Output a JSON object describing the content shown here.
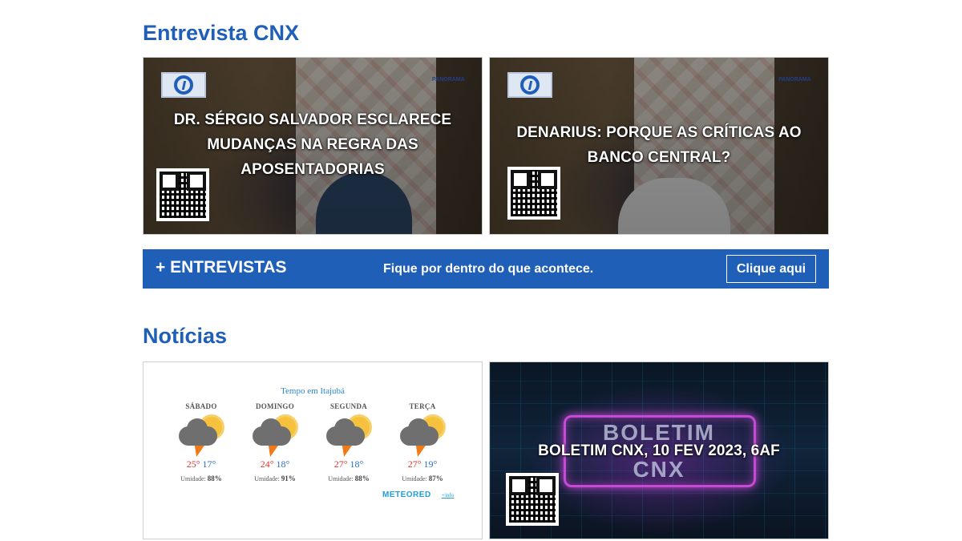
{
  "sections": {
    "interviews_title": "Entrevista CNX",
    "news_title": "Notícias"
  },
  "interviews": [
    {
      "title_line1": "DR. SÉRGIO SALVADOR ESCLARECE",
      "title_line2": "MUDANÇAS NA REGRA DAS",
      "title_line3": "APOSENTADORIAS",
      "watermark": "PANORAMA"
    },
    {
      "title_line1": "DENARIUS: PORQUE AS CRÍTICAS AO",
      "title_line2": "BANCO CENTRAL?",
      "watermark": "PANORAMA"
    }
  ],
  "banner": {
    "left_label": "+ ENTREVISTAS",
    "tagline": "Fique por dentro do que acontece.",
    "button_label": "Clique aqui",
    "color": "#1f5fb8"
  },
  "weather": {
    "title": "Tempo em Itajubá",
    "days": [
      {
        "name": "SÁBADO",
        "max": "25°",
        "min": "17°",
        "humidity_label": "Umidade:",
        "humidity": "88%",
        "icon": "storm-sun-icon"
      },
      {
        "name": "DOMINGO",
        "max": "24°",
        "min": "18°",
        "humidity_label": "Umidade:",
        "humidity": "91%",
        "icon": "storm-sun-icon"
      },
      {
        "name": "SEGUNDA",
        "max": "27°",
        "min": "18°",
        "humidity_label": "Umidade:",
        "humidity": "88%",
        "icon": "storm-sun-icon"
      },
      {
        "name": "TERÇA",
        "max": "27°",
        "min": "19°",
        "humidity_label": "Umidade:",
        "humidity": "87%",
        "icon": "storm-sun-icon"
      }
    ],
    "brand": "METEORED",
    "info_link": "+info"
  },
  "boletim": {
    "title": "BOLETIM CNX, 10 FEV 2023, 6AF",
    "bg_word_top": "BOLETIM",
    "bg_word_bottom": "CNX"
  },
  "colors": {
    "accent": "#1f5fb8",
    "temp_max": "#d9342b",
    "temp_min": "#2a6ec4"
  }
}
